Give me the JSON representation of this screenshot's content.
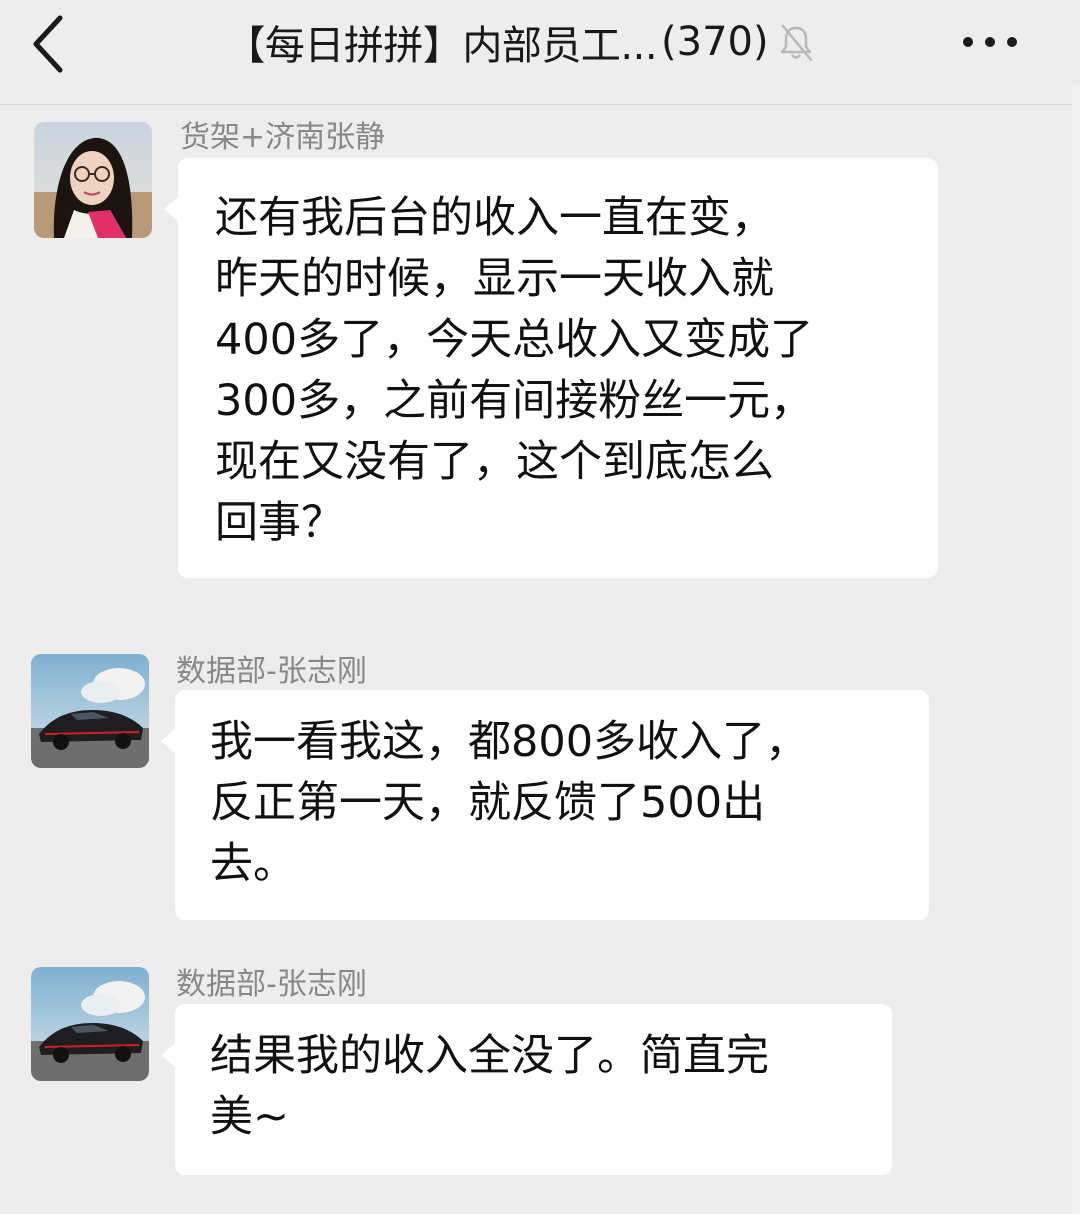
{
  "header": {
    "title": "【每日拼拼】内部员工...",
    "member_count": "(370)",
    "back_icon": "chevron-left-icon",
    "mute_icon": "bell-off-icon",
    "more_icon": "more-dots-icon"
  },
  "messages": [
    {
      "sender": "货架+济南张静",
      "avatar": "avatar-woman-photo",
      "text": "还有我后台的收入一直在变，\n昨天的时候，显示一天收入就\n400多了，今天总收入又变成了\n300多，之前有间接粉丝一元，\n现在又没有了，这个到底怎么\n回事？"
    },
    {
      "sender": "数据部-张志刚",
      "avatar": "avatar-sports-car-photo",
      "text": "我一看我这，都800多收入了，\n反正第一天，就反馈了500出\n去。"
    },
    {
      "sender": "数据部-张志刚",
      "avatar": "avatar-sports-car-photo",
      "text": "结果我的收入全没了。简直完\n美~"
    }
  ],
  "colors": {
    "background": "#ededed",
    "bubble": "#ffffff",
    "sender_name": "#888888",
    "text": "#111111"
  }
}
